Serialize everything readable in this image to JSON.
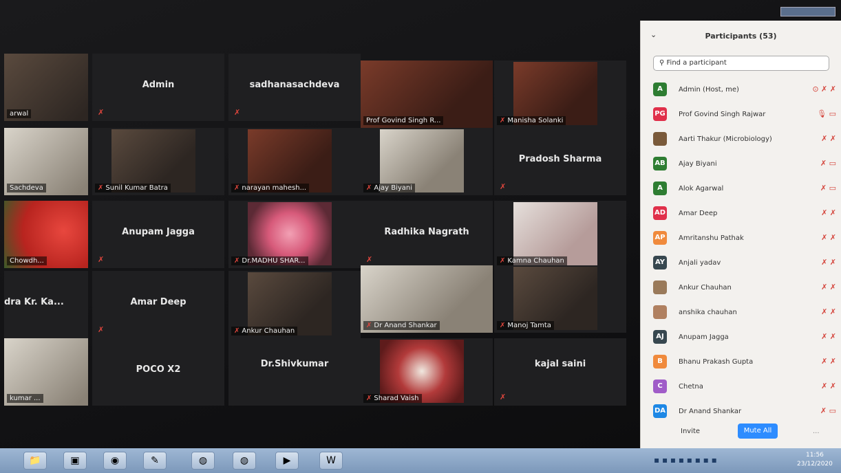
{
  "gallery": {
    "tiles": [
      {
        "name": "arwal"
      },
      {
        "name": "Admin"
      },
      {
        "name": "sadhanasachdeva"
      },
      {
        "name": "Prof Govind Singh R..."
      },
      {
        "name": "Manisha Solanki"
      },
      {
        "name": "Sachdeva"
      },
      {
        "name": "Sunil Kumar Batra"
      },
      {
        "name": "narayan mahesh..."
      },
      {
        "name": "Ajay Biyani"
      },
      {
        "name": "Pradosh Sharma"
      },
      {
        "name": "Chowdh..."
      },
      {
        "name": "Anupam Jagga"
      },
      {
        "name": "Dr.MADHU SHAR..."
      },
      {
        "name": "Radhika Nagrath"
      },
      {
        "name": "Kamna Chauhan"
      },
      {
        "name": "dra  Kr. Ka..."
      },
      {
        "name": "Amar Deep"
      },
      {
        "name": "Ankur Chauhan"
      },
      {
        "name": "Dr Anand Shankar"
      },
      {
        "name": "Manoj Tamta"
      },
      {
        "name": "kumar ..."
      },
      {
        "name": "POCO X2"
      },
      {
        "name": "Dr.Shivkumar"
      },
      {
        "name": "Sharad Vaish"
      },
      {
        "name": "kajal saini"
      }
    ]
  },
  "panel": {
    "title": "Participants (53)",
    "collapse_icon": "chevron-down-icon",
    "search_placeholder": "Find a participant",
    "participants": [
      {
        "initials": "A",
        "name": "Admin (Host, me)",
        "color": "#2e7d32",
        "icons": "⊙ ✗ ✗"
      },
      {
        "initials": "PG",
        "name": "Prof Govind Singh Rajwar",
        "color": "#e0304a",
        "icons": "🎙 ▭"
      },
      {
        "initials": "",
        "name": "Aarti Thakur (Microbiology)",
        "color": "#7a5a3a",
        "icons": "✗ ✗"
      },
      {
        "initials": "AB",
        "name": "Ajay Biyani",
        "color": "#2e7d32",
        "icons": "✗ ▭"
      },
      {
        "initials": "A",
        "name": "Alok Agarwal",
        "color": "#2e7d32",
        "icons": "✗ ▭"
      },
      {
        "initials": "AD",
        "name": "Amar Deep",
        "color": "#e0304a",
        "icons": "✗ ✗"
      },
      {
        "initials": "AP",
        "name": "Amritanshu Pathak",
        "color": "#f08a3c",
        "icons": "✗ ✗"
      },
      {
        "initials": "AY",
        "name": "Anjali yadav",
        "color": "#37474f",
        "icons": "✗ ✗"
      },
      {
        "initials": "",
        "name": "Ankur Chauhan",
        "color": "#9a7a5a",
        "icons": "✗ ✗"
      },
      {
        "initials": "",
        "name": "anshika chauhan",
        "color": "#b08060",
        "icons": "✗ ✗"
      },
      {
        "initials": "AJ",
        "name": "Anupam Jagga",
        "color": "#37474f",
        "icons": "✗ ✗"
      },
      {
        "initials": "B",
        "name": "Bhanu Prakash Gupta",
        "color": "#f08a3c",
        "icons": "✗ ✗"
      },
      {
        "initials": "C",
        "name": "Chetna",
        "color": "#a05cc8",
        "icons": "✗ ✗"
      },
      {
        "initials": "DA",
        "name": "Dr Anand Shankar",
        "color": "#1e88e5",
        "icons": "✗ ▭"
      }
    ],
    "invite_label": "Invite",
    "mute_all_label": "Mute All",
    "more_label": "..."
  },
  "taskbar": {
    "time": "11:56",
    "date": "23/12/2020",
    "apps": [
      "folder-icon",
      "ec-app-icon",
      "media-player-icon",
      "paint-icon",
      "chrome-icon",
      "chrome-icon",
      "zoom-icon",
      "word-icon"
    ]
  }
}
